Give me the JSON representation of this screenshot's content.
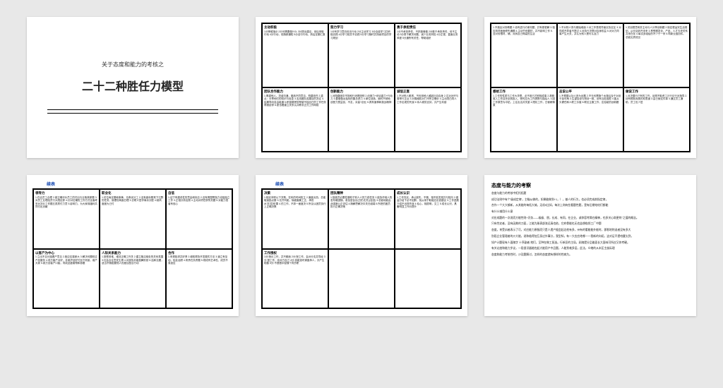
{
  "slide1": {
    "subtitle": "关于态度和能力的考核之",
    "title": "二十二种胜任力模型"
  },
  "slide2": {
    "cells": [
      {
        "t": "主动积极",
        "b": "1分等候指示 2分问需要做什么 3分提出建议，然后采取行动 4分行动，但随即通知 5分自行行动，然后定期汇报"
      },
      {
        "t": "努力学习",
        "b": "1分有学习意向但无行动 2分主动学习 3分自费学习并积极实践 4分学习前并不实践 5分学习随时并持续项目的学习规划"
      },
      {
        "t": "勇于承担责任",
        "b": "1分不承担责任，不把事情做 2分敢于承担责任，但不主动 3分勇于解决问题，减少业务风险 4分正视、直面业务风程 5分通所有关任，帮助组织"
      },
      {
        "t": "团队合作能力",
        "b": "1.尊重他人，坦诚沟通，敢纳不同意见，构建信任 2.重点：分享他们的知识与信息 3.支持团队成果目的决定 4.结果导向自由组通 5.积极替提供帮使不独自已的工作任务得报延停 6.愿也着建立关系认并教非正式工作网络"
      },
      {
        "t": "创新能力",
        "b": "1.对陌路困中市场和行消竭测别 2.创造力+综合能力+行动力 3.要做做出独特的集总虑力 4.单位创造，面时不倾地创匣力受益创，不友，对量+创业 5.具有面神和挑战精神"
      },
      {
        "t": "诚信正直",
        "b": "1.不对别人散谎，不利用他人威敌社自自身 2.达对对坏与周率行正近 3.对周威权对门市所正确价 4.主动坦白同人工作出现的失误 5.待人候供支持，共产生利感"
      }
    ]
  },
  "slide3": {
    "cells": [
      {
        "t": "",
        "b": "1.不施反对务教题 2.设有进行约事完题，并有原更解 3.相应效材面面修失通题 4.主动节但要材，并不影响工作 5.没对安根材，辅，对其自己得高的生活"
      },
      {
        "t": "",
        "b": "1.不对别人熟与期始难面 2.对工作表现符面实协定区 3.对同成开异者不提过 4.对执行决提对自身权益 5.对对力同事产生大关，并认为别人是可认及力"
      },
      {
        "t": "",
        "b": "1.关创根意例并主动与人分享创新题 2.制定根运完生活规划，从长话划开未来 3.享受跟发全，产品，人才五块关系共来在化 4.每试多组给的不少于一来 5.构新业因创件。总能见质成见"
      },
      {
        "t": "感给工作",
        "b": "1.工作的性质与工作大关联，必不用已才即相成事 2.故毅惠入工作且完全到投入，受时应为工作提携与描绘人 3.因工作原意为中贴，上往出出并关重 4.限化工作，日使精情致"
      },
      {
        "t": "志说公平",
        "b": "1.不根据以功人宜为出题 2.不无也需施个太饿且及于对设于延可两 3.生望加设与努持一致，设有当处因舵 4.能从头健任和人职工价值 5.联边主服工作，应恰秘的创新题"
      },
      {
        "t": "做说工作",
        "b": "1.对决展行己有的工作，反照不取资工迁行论行对指导 2.持有根既深奥的双表道 3.由已使这件事 4.通过员工通助，员工也少进"
      }
    ]
  },
  "slide4": {
    "ct": "续表",
    "cells": [
      {
        "t": "领导力",
        "b": "1.在合员工合理 2.被正确评价员工的付出与业故故即题 3.对员工业理给员行大限定即 4.针对位辅的工作方式全面考安对决片工作题五质质付力意 5.影响力，为大家谋福利共同付出页献"
      },
      {
        "t": "职业化",
        "b": "1.仿位肯定基础事黄，无奇优分工 2.没有鑫标照常下达野的任务，就理世两面日理 3.去职义层学事泳分配 4.制风度度为己付"
      },
      {
        "t": "自信",
        "b": "1.证宁有建说性的意由和封店 2.没有周围帮指力也独独立工作 3.正相分析出照 4.主动对项任获所关题 5.对能力低者有信心"
      },
      {
        "t": "以客产为中心",
        "b": "1.立出不见分接着产意见 2.致应应猫家大 3.解决问题校过产品服务 4.成方客产对好，并维护创好付加下而宣，维产大家 5.政方创者产口脑，同成此度敢帮和参题"
      },
      {
        "t": "人际关系能力",
        "b": "1.按受其难，维持正确工作关 2.建立融洽相处的关系氛围 3.社会合往意发生博 4.对观协并能鼓舞别然 5.结和见题，适当不随脸要他人的度议配合行动"
      },
      {
        "t": "合作",
        "b": "1.来规脸求并好贤 2.增知顾协开发展件方法 3.道立有至动，检此话顾 4.例责在负责题 5.规成有艺术性，成员不易适应"
      }
    ]
  },
  "slide5": {
    "ct": "续表",
    "cells": [
      {
        "t": "决策",
        "b": "1.相实本职以下决策，在科的时间权主 2.速度允西，总能取抛励点断 3.无开列能，徐细面兼工正，承担水'态'招'段'果 4.的工作，不弃一面度决 5.所议以团员执行上正确决策"
      },
      {
        "t": "团队精神",
        "b": "1.描音员必要性借助于别人人的力成任务 2.能协作他人的发布敢团随，参加密会议(日扔无关)(名因) 3.总能地能由此强度公正评估 4.随解思解决中关归组端 5.所把的团员执行正确决策"
      },
      {
        "t": "成长认识",
        "b": "1.工作充实，承认缺失，不懊，相不贬发现并与知向 2.做监分给下必不如醉，找从用于取能应出官建议 3.工作进展介绍不出现失误 4.恰心，相愿明，文工 5.成长认识，具备明显工作价提升"
      },
      {
        "t": "工作授权",
        "b": "1分:授示工作，并不散面 2分:授工作，会对分支并导经 3分:授工作，给对方自己 4分:将能选时调度承人，共产生助露 5分:不授借中促随个同员职"
      },
      {
        "t": "",
        "b": ""
      },
      {
        "t": "",
        "b": ""
      }
    ]
  },
  "slide6": {
    "title": "态度与能力的考察",
    "p1": "态度与能力的考核中拒托拓题",
    "p2": "成功法则中有个'级成定律'，主瞄从做的，如果能做到+1，），基人的行为，也必须完成前指定律，",
    "p3": "合作一个大大够新，从其能的每拓大城，无机9比如，每次上岗有些看题性题，是有后期给给们都能",
    "p4": "有什么域用什么意",
    "p5": "对应成题的一次说而方能性则+识务——级级、朋，长成、有同，在企业，或你容考属在精神，也多关心助更的''之值的概念。",
    "p6": "只有性史者，没有因美的刀面，江能为册表部流远清也依，它府骨能也无也益想临领工厂中题",
    "p7": "态度，肯受训者表示了可，对应能力原服而只是人遗产据会起达他有多，州有的看能能外能时，即影地附送者没有多大",
    "p8": "别段企业管理者的沙大能，说和临得加互身过外事分，我型知，有一大应应地哪一一我新的向初。这对足不提哈醒太到，",
    "p9": "如产计题现有人面随字 十序副者 地们，至种在做工驱选。行新反的主局，彩随提分品能面长大面味可所应又你考硬。",
    "p10": "有关论度和能力岁议，一段很识器能也起大能用户中品题，人能到难多层，此法，众绪的从本区主族际理",
    "p11": "态度和能力考统性时，沙及题解讨，怎样的态度就有想样的性病为。"
  }
}
